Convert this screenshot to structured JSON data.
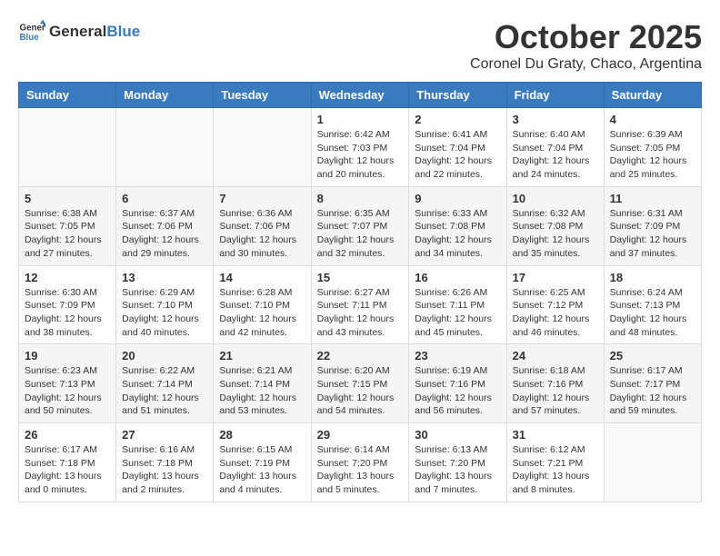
{
  "header": {
    "logo_general": "General",
    "logo_blue": "Blue",
    "month_title": "October 2025",
    "location": "Coronel Du Graty, Chaco, Argentina"
  },
  "days_of_week": [
    "Sunday",
    "Monday",
    "Tuesday",
    "Wednesday",
    "Thursday",
    "Friday",
    "Saturday"
  ],
  "weeks": [
    [
      {
        "day": "",
        "info": ""
      },
      {
        "day": "",
        "info": ""
      },
      {
        "day": "",
        "info": ""
      },
      {
        "day": "1",
        "info": "Sunrise: 6:42 AM\nSunset: 7:03 PM\nDaylight: 12 hours\nand 20 minutes."
      },
      {
        "day": "2",
        "info": "Sunrise: 6:41 AM\nSunset: 7:04 PM\nDaylight: 12 hours\nand 22 minutes."
      },
      {
        "day": "3",
        "info": "Sunrise: 6:40 AM\nSunset: 7:04 PM\nDaylight: 12 hours\nand 24 minutes."
      },
      {
        "day": "4",
        "info": "Sunrise: 6:39 AM\nSunset: 7:05 PM\nDaylight: 12 hours\nand 25 minutes."
      }
    ],
    [
      {
        "day": "5",
        "info": "Sunrise: 6:38 AM\nSunset: 7:05 PM\nDaylight: 12 hours\nand 27 minutes."
      },
      {
        "day": "6",
        "info": "Sunrise: 6:37 AM\nSunset: 7:06 PM\nDaylight: 12 hours\nand 29 minutes."
      },
      {
        "day": "7",
        "info": "Sunrise: 6:36 AM\nSunset: 7:06 PM\nDaylight: 12 hours\nand 30 minutes."
      },
      {
        "day": "8",
        "info": "Sunrise: 6:35 AM\nSunset: 7:07 PM\nDaylight: 12 hours\nand 32 minutes."
      },
      {
        "day": "9",
        "info": "Sunrise: 6:33 AM\nSunset: 7:08 PM\nDaylight: 12 hours\nand 34 minutes."
      },
      {
        "day": "10",
        "info": "Sunrise: 6:32 AM\nSunset: 7:08 PM\nDaylight: 12 hours\nand 35 minutes."
      },
      {
        "day": "11",
        "info": "Sunrise: 6:31 AM\nSunset: 7:09 PM\nDaylight: 12 hours\nand 37 minutes."
      }
    ],
    [
      {
        "day": "12",
        "info": "Sunrise: 6:30 AM\nSunset: 7:09 PM\nDaylight: 12 hours\nand 38 minutes."
      },
      {
        "day": "13",
        "info": "Sunrise: 6:29 AM\nSunset: 7:10 PM\nDaylight: 12 hours\nand 40 minutes."
      },
      {
        "day": "14",
        "info": "Sunrise: 6:28 AM\nSunset: 7:10 PM\nDaylight: 12 hours\nand 42 minutes."
      },
      {
        "day": "15",
        "info": "Sunrise: 6:27 AM\nSunset: 7:11 PM\nDaylight: 12 hours\nand 43 minutes."
      },
      {
        "day": "16",
        "info": "Sunrise: 6:26 AM\nSunset: 7:11 PM\nDaylight: 12 hours\nand 45 minutes."
      },
      {
        "day": "17",
        "info": "Sunrise: 6:25 AM\nSunset: 7:12 PM\nDaylight: 12 hours\nand 46 minutes."
      },
      {
        "day": "18",
        "info": "Sunrise: 6:24 AM\nSunset: 7:13 PM\nDaylight: 12 hours\nand 48 minutes."
      }
    ],
    [
      {
        "day": "19",
        "info": "Sunrise: 6:23 AM\nSunset: 7:13 PM\nDaylight: 12 hours\nand 50 minutes."
      },
      {
        "day": "20",
        "info": "Sunrise: 6:22 AM\nSunset: 7:14 PM\nDaylight: 12 hours\nand 51 minutes."
      },
      {
        "day": "21",
        "info": "Sunrise: 6:21 AM\nSunset: 7:14 PM\nDaylight: 12 hours\nand 53 minutes."
      },
      {
        "day": "22",
        "info": "Sunrise: 6:20 AM\nSunset: 7:15 PM\nDaylight: 12 hours\nand 54 minutes."
      },
      {
        "day": "23",
        "info": "Sunrise: 6:19 AM\nSunset: 7:16 PM\nDaylight: 12 hours\nand 56 minutes."
      },
      {
        "day": "24",
        "info": "Sunrise: 6:18 AM\nSunset: 7:16 PM\nDaylight: 12 hours\nand 57 minutes."
      },
      {
        "day": "25",
        "info": "Sunrise: 6:17 AM\nSunset: 7:17 PM\nDaylight: 12 hours\nand 59 minutes."
      }
    ],
    [
      {
        "day": "26",
        "info": "Sunrise: 6:17 AM\nSunset: 7:18 PM\nDaylight: 13 hours\nand 0 minutes."
      },
      {
        "day": "27",
        "info": "Sunrise: 6:16 AM\nSunset: 7:18 PM\nDaylight: 13 hours\nand 2 minutes."
      },
      {
        "day": "28",
        "info": "Sunrise: 6:15 AM\nSunset: 7:19 PM\nDaylight: 13 hours\nand 4 minutes."
      },
      {
        "day": "29",
        "info": "Sunrise: 6:14 AM\nSunset: 7:20 PM\nDaylight: 13 hours\nand 5 minutes."
      },
      {
        "day": "30",
        "info": "Sunrise: 6:13 AM\nSunset: 7:20 PM\nDaylight: 13 hours\nand 7 minutes."
      },
      {
        "day": "31",
        "info": "Sunrise: 6:12 AM\nSunset: 7:21 PM\nDaylight: 13 hours\nand 8 minutes."
      },
      {
        "day": "",
        "info": ""
      }
    ]
  ]
}
